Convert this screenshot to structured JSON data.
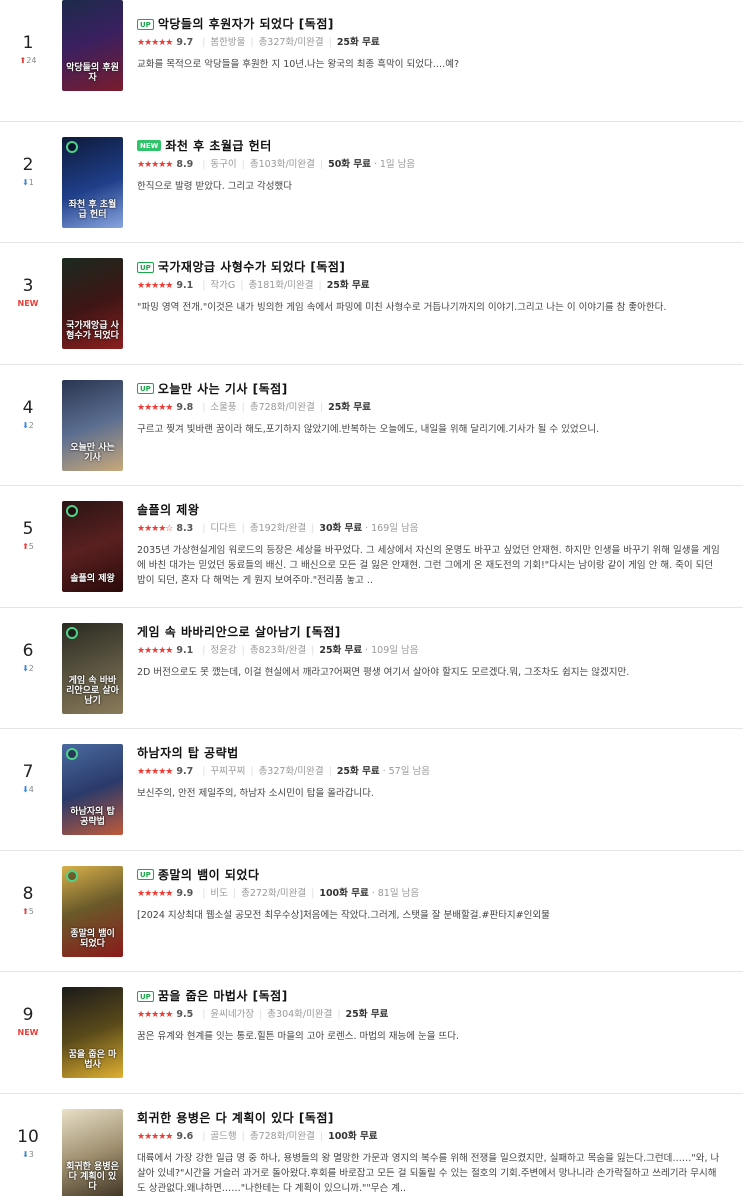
{
  "colors": {
    "star": "#ee3a33",
    "rank_up": "#e8403a",
    "rank_down": "#3a87d8",
    "badge_up": "#1aa84b",
    "badge_new": "#2fc36a"
  },
  "items": [
    {
      "rank": "1",
      "change_type": "up",
      "change": "24",
      "badge": "UP",
      "badge_type": "up",
      "title": "악당들의 후원자가 되었다 [독점]",
      "stars": "★★★★★",
      "score": "9.7",
      "author": "봄한방울",
      "episodes": "총327화/미완결",
      "free": "25화 무료",
      "extra": "",
      "desc": "교화를 목적으로 악당들을 후원한 지 10년.나는 왕국의 최종 흑막이 되었다.…예?",
      "cover_title": "악당들의 후원자",
      "cover_bg": "linear-gradient(160deg,#1c2a4a 0%,#3a2060 45%,#7a1c2c 100%)"
    },
    {
      "rank": "2",
      "change_type": "down",
      "change": "1",
      "badge": "NEW",
      "badge_type": "new",
      "title": "좌천 후 초월급 헌터",
      "stars": "★★★★★",
      "score": "8.9",
      "author": "동구이",
      "episodes": "총103화/미완결",
      "free": "50화 무료",
      "extra": "1일 남음",
      "desc": "한직으로 발령 받았다. 그리고 각성했다",
      "cover_title": "좌천 후 초월급 헌터",
      "cover_bg": "linear-gradient(160deg,#0e1a3a 0%,#1f3f8a 55%,#8aa6e0 100%)",
      "clock": true
    },
    {
      "rank": "3",
      "change_type": "new",
      "change": "NEW",
      "badge": "UP",
      "badge_type": "up",
      "title": "국가재앙급 사형수가 되었다 [독점]",
      "stars": "★★★★★",
      "score": "9.1",
      "author": "작가G",
      "episodes": "총181화/미완결",
      "free": "25화 무료",
      "extra": "",
      "desc": "\"파밍 영역 전개.\"이것은 내가 빙의한 게임 속에서 파밍에 미친 사형수로 거듭나기까지의 이야기.그리고 나는 이 이야기를 참 좋아한다.",
      "cover_title": "국가재앙급 사형수가 되었다",
      "cover_bg": "linear-gradient(160deg,#1b2a1f 0%,#3c1515 50%,#8c1f1f 100%)"
    },
    {
      "rank": "4",
      "change_type": "down",
      "change": "2",
      "badge": "UP",
      "badge_type": "up",
      "title": "오늘만 사는 기사 [독점]",
      "stars": "★★★★★",
      "score": "9.8",
      "author": "소울풍",
      "episodes": "총728화/미완결",
      "free": "25화 무료",
      "extra": "",
      "desc": "구르고 찢겨 빛바랜 꿈이라 해도,포기하지 않았기에.반복하는 오늘에도, 내일을 위해 달리기에.기사가 될 수 있었으니.",
      "cover_title": "오늘만 사는 기사",
      "cover_bg": "linear-gradient(160deg,#2a3550 0%,#5a6d90 50%,#c9a97a 100%)"
    },
    {
      "rank": "5",
      "change_type": "up",
      "change": "5",
      "badge": "",
      "badge_type": "",
      "title": "솔플의 제왕",
      "stars": "★★★★☆",
      "score": "8.3",
      "author": "디다트",
      "episodes": "총192화/완결",
      "free": "30화 무료",
      "extra": "169일 남음",
      "desc": "2035년 가상현실게임 워로드의 등장은 세상을 바꾸었다. 그 세상에서 자신의 운명도 바꾸고 싶었던 안재현. 하지만 인생을 바꾸기 위해 일생을 게임에 바친 대가는 믿었던 동료들의 배신. 그 배신으로 모든 걸 잃은 안재현. 그런 그에게 온 재도전의 기회!\"다시는 남이랑 같이 게임 안 해. 죽이 되던 밥이 되던, 혼자 다 해먹는 게 뭔지 보여주마.\"전리품 놓고 ..",
      "cover_title": "솔플의 제왕",
      "cover_bg": "linear-gradient(160deg,#2a1414 0%,#5a2020 50%,#2a0a0a 100%)",
      "clock": true
    },
    {
      "rank": "6",
      "change_type": "down",
      "change": "2",
      "badge": "",
      "badge_type": "",
      "title": "게임 속 바바리안으로 살아남기 [독점]",
      "stars": "★★★★★",
      "score": "9.1",
      "author": "정윤강",
      "episodes": "총823화/완결",
      "free": "25화 무료",
      "extra": "109일 남음",
      "desc": "2D 버전으로도 못 깼는데, 이걸 현실에서 깨라고?어쩌면 평생 여기서 살아야 할지도 모르겠다.뭐, 그조차도 쉽지는 않겠지만.",
      "cover_title": "게임 속 바바리안으로 살아남기",
      "cover_bg": "linear-gradient(160deg,#2a2a22 0%,#5a5440 50%,#8a7a5a 100%)",
      "clock": true
    },
    {
      "rank": "7",
      "change_type": "down",
      "change": "4",
      "badge": "",
      "badge_type": "",
      "title": "하남자의 탑 공략법",
      "stars": "★★★★★",
      "score": "9.7",
      "author": "꾸찌꾸찌",
      "episodes": "총327화/미완결",
      "free": "25화 무료",
      "extra": "57일 남음",
      "desc": "보신주의, 안전 제일주의, 하남자 소시민이 탑을 올라갑니다.",
      "cover_title": "하남자의 탑 공략법",
      "cover_bg": "linear-gradient(160deg,#4a6aa0 0%,#2a3a6a 50%,#c05a3a 100%)",
      "clock": true
    },
    {
      "rank": "8",
      "change_type": "up",
      "change": "5",
      "badge": "UP",
      "badge_type": "up",
      "title": "종말의 뱀이 되었다",
      "stars": "★★★★★",
      "score": "9.9",
      "author": "비도",
      "episodes": "총272화/미완결",
      "free": "100화 무료",
      "extra": "81일 남음",
      "desc": "[2024 지상최대 웹소설 공모전 최우수상]처음에는 작았다.그러게, 스탯을 잘 분배할걸.#판타지#인외물",
      "cover_title": "종말의 뱀이 되었다",
      "cover_bg": "linear-gradient(160deg,#d8b04a 0%,#6a5a2a 45%,#8a1a1a 100%)",
      "clock": true
    },
    {
      "rank": "9",
      "change_type": "new",
      "change": "NEW",
      "badge": "UP",
      "badge_type": "up",
      "title": "꿈을 줍은 마법사 [독점]",
      "stars": "★★★★★",
      "score": "9.5",
      "author": "윤씨네가장",
      "episodes": "총304화/미완결",
      "free": "25화 무료",
      "extra": "",
      "desc": "꿈은 유계와 현계를 잇는 통로.힐튼 마을의 고아 로렌스. 마법의 재능에 눈을 뜨다.",
      "cover_title": "꿈을 줍은 마법사",
      "cover_bg": "linear-gradient(160deg,#1a1a1a 0%,#5a4a1a 50%,#e0b030 100%)"
    },
    {
      "rank": "10",
      "change_type": "down",
      "change": "3",
      "badge": "",
      "badge_type": "",
      "title": "회귀한 용병은 다 계획이 있다 [독점]",
      "stars": "★★★★★",
      "score": "9.6",
      "author": "골드행",
      "episodes": "총728화/미완결",
      "free": "100화 무료",
      "extra": "",
      "desc": "대륙에서 가장 강한 일급 명 중 하나, 용병들의 왕 멸망한 가문과 영지의 복수를 위해 전쟁을 일으켰지만, 실패하고 목숨을 잃는다.그런데……\"와, 나 살아 있네?\"시간을 거슬러 과거로 돌아왔다.후회를 바로잡고 모든 걸 되돌릴 수 있는 절호의 기회.주변에서 망나니라 손가락질하고 쓰레기라 무시해도 상관없다.왜냐하면……\"나한테는 다 계획이 있으니까.\"\"무슨 계..",
      "cover_title": "회귀한 용병은 다 계획이 있다",
      "cover_bg": "linear-gradient(160deg,#e8e0c8 0%,#a09070 50%,#3a3020 100%)"
    }
  ]
}
